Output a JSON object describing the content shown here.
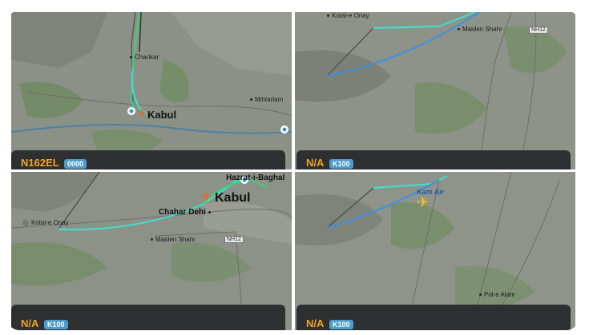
{
  "panels": [
    {
      "callsign": "N162EL",
      "squawk": "0000",
      "places": {
        "city": "Kabul",
        "north": "Charikar",
        "east": "Mihtarlam"
      }
    },
    {
      "callsign": "N/A",
      "squawk": "K100",
      "places": {
        "north": "Kotal-e Onay",
        "town": "Maiden Shahr",
        "road": "NH12"
      }
    },
    {
      "callsign": "N/A",
      "squawk": "K100",
      "places": {
        "city": "Kabul",
        "north": "Hazrat-i-Baghal",
        "west": "Kotal-e Onay",
        "mid": "Chahar Dehi",
        "town": "Maiden Shahr",
        "road": "NH12"
      }
    },
    {
      "callsign": "N/A",
      "squawk": "K100",
      "places": {
        "airline": "Kam Air",
        "south": "Pol-e Alam"
      }
    }
  ],
  "colors": {
    "callsign": "#f2a526",
    "squawk_bg": "#4b9cc9",
    "track_cyan": "#3ee0d2",
    "track_blue": "#3f8fe0",
    "track_green": "#3ad27a",
    "track_gray": "#555555"
  },
  "icons": [
    "plane-icon",
    "location-pin-icon",
    "airport-icon"
  ]
}
